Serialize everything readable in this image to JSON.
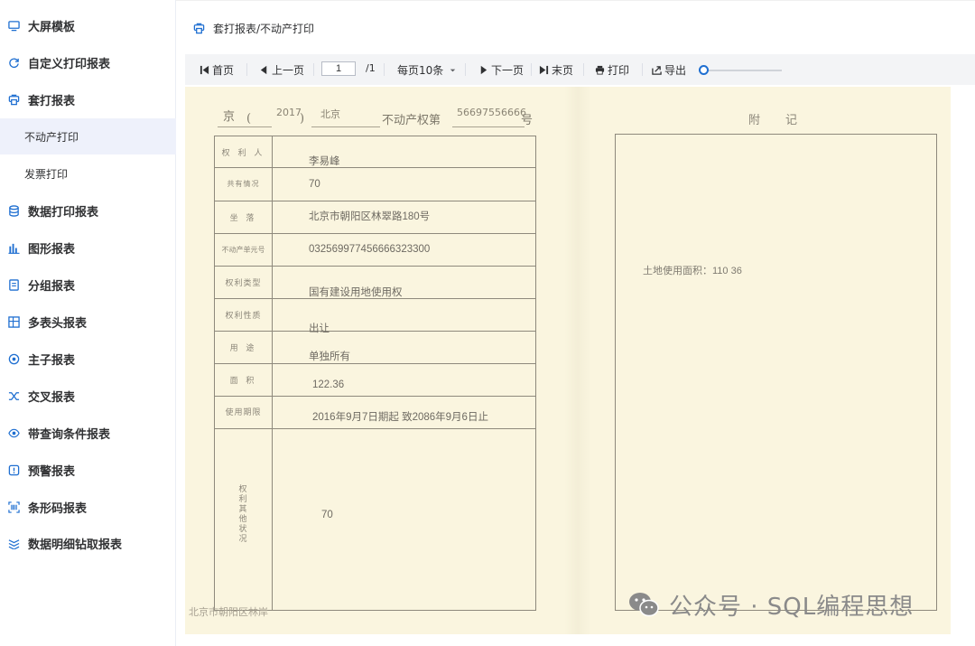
{
  "sidebar": {
    "items": [
      {
        "label": "大屏模板",
        "icon": "monitor-icon"
      },
      {
        "label": "自定义打印报表",
        "icon": "refresh-icon"
      },
      {
        "label": "套打报表",
        "icon": "printer-icon"
      },
      {
        "label": "数据打印报表",
        "icon": "database-icon"
      },
      {
        "label": "图形报表",
        "icon": "bar-chart-icon"
      },
      {
        "label": "分组报表",
        "icon": "document-icon"
      },
      {
        "label": "多表头报表",
        "icon": "grid-icon"
      },
      {
        "label": "主子报表",
        "icon": "badge-icon"
      },
      {
        "label": "交叉报表",
        "icon": "shuffle-icon"
      },
      {
        "label": "带查询条件报表",
        "icon": "eye-icon"
      },
      {
        "label": "预警报表",
        "icon": "alert-icon"
      },
      {
        "label": "条形码报表",
        "icon": "barcode-icon"
      },
      {
        "label": "数据明细钻取报表",
        "icon": "layers-icon"
      }
    ],
    "sub_items": [
      {
        "label": "不动产打印",
        "active": true
      },
      {
        "label": "发票打印",
        "active": false
      }
    ]
  },
  "header": {
    "breadcrumb": "套打报表/不动产打印"
  },
  "toolbar": {
    "first": "首页",
    "prev": "上一页",
    "page_value": "1",
    "page_total": "/1",
    "page_size": "每页10条",
    "next": "下一页",
    "last": "末页",
    "print": "打印",
    "export": "导出",
    "zoom_level": 0
  },
  "certificate": {
    "prefix": "京",
    "paren_open": "(",
    "year": "2017",
    "paren_close": ")",
    "city": "北京",
    "title_text": "不动产权第",
    "cert_no": "56697556666",
    "suffix": "号",
    "rows": [
      {
        "label": "权 利 人",
        "value": "李易峰"
      },
      {
        "label": "共有情况",
        "value": "70"
      },
      {
        "label": "坐  落",
        "value": "北京市朝阳区林翠路180号"
      },
      {
        "label": "不动产单元号",
        "value": "032569977456666323300"
      },
      {
        "label": "权利类型",
        "value": "国有建设用地使用权"
      },
      {
        "label": "权利性质",
        "value": "出让"
      },
      {
        "label": "用  途",
        "value": "单独所有"
      },
      {
        "label": "面  积",
        "value": "122.36"
      },
      {
        "label": "使用期限",
        "value": "2016年9月7日期起 致2086年9月6日止"
      }
    ],
    "other_label": "权利其他状况",
    "other_value": "70",
    "footer_text": "北京市朝阳区林岸"
  },
  "notes": {
    "title": "附记",
    "content": "土地使用面积：110 36"
  },
  "watermark": "公众号 · SQL编程思想"
}
